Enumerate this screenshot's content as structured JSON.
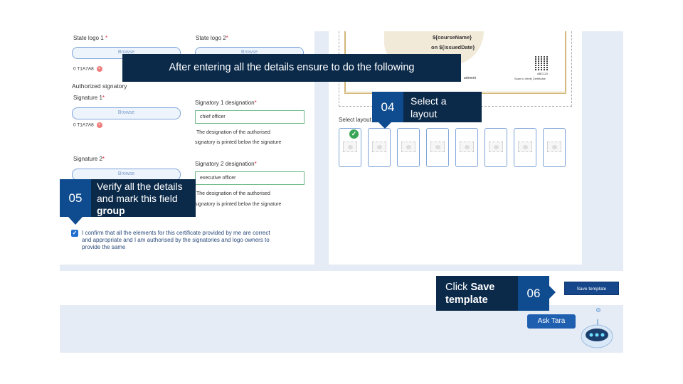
{
  "form": {
    "state_logo_1_label": "State logo 1",
    "state_logo_2_label": "State logo 2",
    "required_mark": "*",
    "browse_label": "Browse",
    "uploaded_file": "0 T1A7A8",
    "remove_glyph": "×",
    "authorized_signatory_heading": "Authorized signatory",
    "signature_1_label": "Signature 1",
    "signature_2_label": "Signature 2",
    "signatory_1_designation_label": "Signatory 1 designation",
    "signatory_1_designation_value": "chief officer",
    "signatory_2_designation_label": "Signatory 2 designation",
    "signatory_2_designation_value": "executive officer",
    "designation_note_line1": "The designation of the authorised",
    "designation_note_line2": "signatory is printed below the signature",
    "confirm_checked": true,
    "confirm_text_line1": "I confirm that all the elements for this certificate provided by me are correct",
    "confirm_text_line2": "and appropriate and I am authorised by the signatories and logo owners to",
    "confirm_text_line3": "provide the same"
  },
  "preview": {
    "course_name": "${courseName}",
    "issued_date": "on ${issuedDate}",
    "department_text": "artment",
    "qr_code_text": "ABC123",
    "scan_text": "Scan to Verify Certificate"
  },
  "layouts": {
    "label": "Select layout",
    "count": 8,
    "selected_index": 0
  },
  "actions": {
    "save_template": "Save template",
    "ask_tara": "Ask Tara"
  },
  "callouts": {
    "top_banner": "After entering all the details ensure to do the following",
    "step_04_number": "04",
    "step_04_line1": "Select a",
    "step_04_line2": "layout",
    "step_05_number": "05",
    "step_05_line1": "Verify all the details",
    "step_05_line2": "and mark this field",
    "step_05_line3": "group",
    "step_06_number": "06",
    "step_06_line1_plain": "Click ",
    "step_06_line1_bold": "Save",
    "step_06_line2_bold": "template"
  },
  "colors": {
    "callout_bg": "#0b2a4a",
    "number_bg": "#0f4c8f",
    "accent_blue": "#16478a",
    "required_red": "#e0293e",
    "success_green": "#3aa655"
  }
}
